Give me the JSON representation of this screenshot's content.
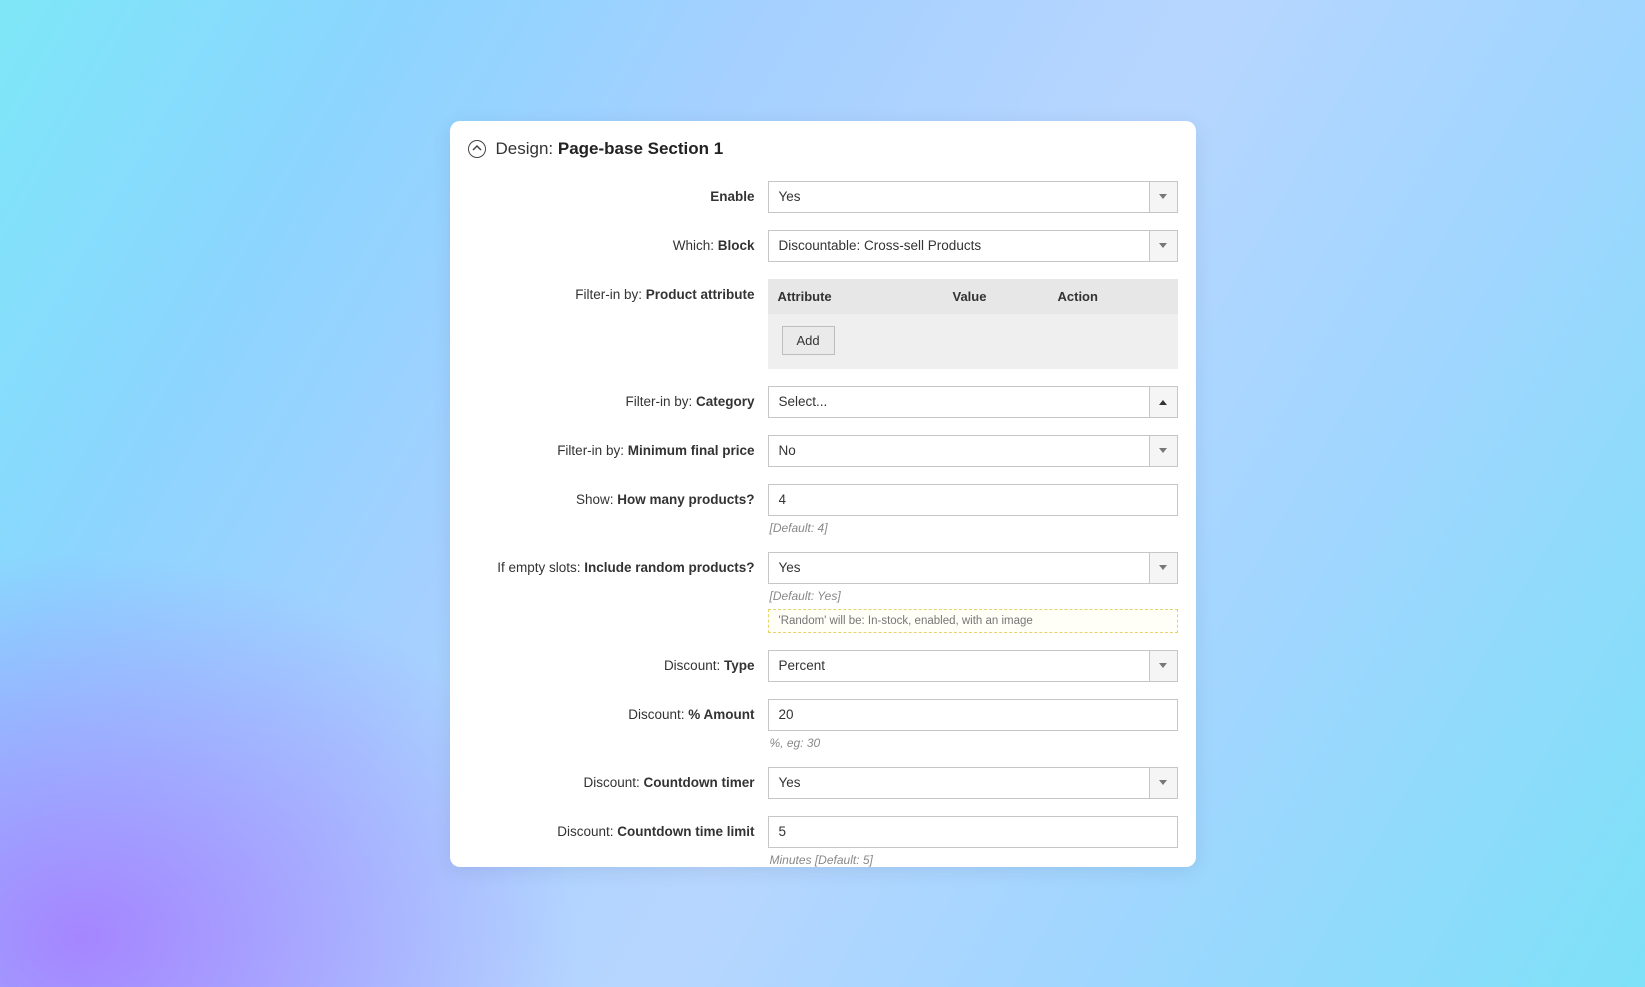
{
  "section": {
    "prefix": "Design:",
    "title": "Page-base Section 1"
  },
  "fields": {
    "enable": {
      "prefix": "",
      "label": "Enable",
      "value": "Yes"
    },
    "which_block": {
      "prefix": "Which:",
      "label": "Block",
      "value": "Discountable: Cross-sell Products"
    },
    "filter_attribute": {
      "prefix": "Filter-in by:",
      "label": "Product attribute",
      "headers": {
        "attribute": "Attribute",
        "value": "Value",
        "action": "Action"
      },
      "add_label": "Add"
    },
    "filter_category": {
      "prefix": "Filter-in by:",
      "label": "Category",
      "value": "Select..."
    },
    "filter_min_price": {
      "prefix": "Filter-in by:",
      "label": "Minimum final price",
      "value": "No"
    },
    "show_count": {
      "prefix": "Show:",
      "label": "How many products?",
      "value": "4",
      "helper": "[Default: 4]"
    },
    "empty_slots": {
      "prefix": "If empty slots:",
      "label": "Include random products?",
      "value": "Yes",
      "helper": "[Default: Yes]",
      "note": "'Random' will be: In-stock, enabled, with an image"
    },
    "discount_type": {
      "prefix": "Discount:",
      "label": "Type",
      "value": "Percent"
    },
    "discount_amount": {
      "prefix": "Discount:",
      "label": "% Amount",
      "value": "20",
      "helper": "%, eg: 30"
    },
    "countdown_timer": {
      "prefix": "Discount:",
      "label": "Countdown timer",
      "value": "Yes"
    },
    "countdown_limit": {
      "prefix": "Discount:",
      "label": "Countdown time limit",
      "value": "5",
      "helper": "Minutes [Default: 5]"
    }
  }
}
